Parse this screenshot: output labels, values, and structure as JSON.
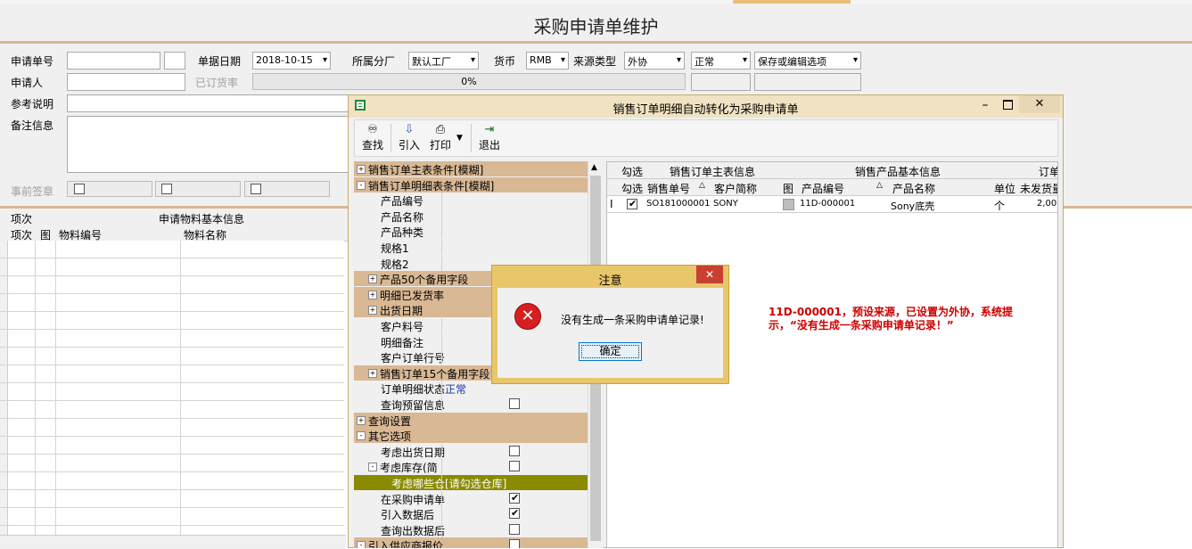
{
  "page_title": "采购申请单维护",
  "form": {
    "request_no_label": "申请单号",
    "date_label": "单据日期",
    "date_value": "2018-10-15",
    "branch_label": "所属分厂",
    "branch_value": "默认工厂",
    "currency_label": "货币",
    "currency_value": "RMB",
    "source_type_label": "来源类型",
    "source_type_value": "外协",
    "status_value": "正常",
    "save_option_value": "保存或编辑选项",
    "applicant_label": "申请人",
    "ordered_rate_label": "已订货率",
    "progress_text": "0%",
    "progress_value": 0,
    "ref_desc_label": "参考说明",
    "remark_label": "备注信息",
    "presign_label": "事前签章"
  },
  "material_grid": {
    "col_index": "项次",
    "group_header": "申请物料基本信息",
    "col_pic": "图",
    "col_code": "物料编号",
    "col_name": "物料名称"
  },
  "dialog": {
    "title": "销售订单明细自动转化为采购申请单",
    "toolbar": {
      "find": "查找",
      "import": "引入",
      "print": "打印",
      "exit": "退出"
    },
    "tree": [
      {
        "label": "销售订单主表条件[模糊]",
        "type": "hdr",
        "expander": "+"
      },
      {
        "label": "销售订单明细表条件[模糊]",
        "type": "hdr",
        "expander": "-"
      },
      {
        "label": "产品编号",
        "type": "item"
      },
      {
        "label": "产品名称",
        "type": "item"
      },
      {
        "label": "产品种类",
        "type": "item"
      },
      {
        "label": "规格1",
        "type": "item"
      },
      {
        "label": "规格2",
        "type": "item"
      },
      {
        "label": "产品50个备用字段",
        "type": "sub",
        "expander": "+"
      },
      {
        "label": "明细已发货率",
        "type": "sub",
        "expander": "+"
      },
      {
        "label": "出货日期",
        "type": "sub",
        "expander": "+"
      },
      {
        "label": "客户料号",
        "type": "item"
      },
      {
        "label": "明细备注",
        "type": "item"
      },
      {
        "label": "客户订单行号",
        "type": "item"
      },
      {
        "label": "销售订单15个备用字段",
        "type": "sub",
        "expander": "+"
      },
      {
        "label": "订单明细状态",
        "type": "item",
        "value": "正常"
      },
      {
        "label": "查询预留信息",
        "type": "item",
        "check": false
      },
      {
        "label": "查询设置",
        "type": "hdr",
        "expander": "+"
      },
      {
        "label": "其它选项",
        "type": "hdr",
        "expander": "-"
      },
      {
        "label": "考虑出货日期",
        "type": "item",
        "check": false
      },
      {
        "label": "考虑库存(简",
        "type": "sub2",
        "expander": "-",
        "check": false
      },
      {
        "label": "考虑哪些仓",
        "type": "sel",
        "value": "[请勾选仓库]"
      },
      {
        "label": "在采购申请单",
        "type": "item",
        "check": true
      },
      {
        "label": "引入数据后",
        "type": "item",
        "check": true
      },
      {
        "label": "查询出数据后",
        "type": "item",
        "check": false
      },
      {
        "label": "引入供应商报价",
        "type": "hdr2",
        "expander": "-",
        "check": false
      }
    ],
    "result_grid": {
      "group_check": "勾选",
      "group_main": "销售订单主表信息",
      "group_product": "销售产品基本信息",
      "group_order": "订单",
      "cols": [
        "勾选",
        "销售单号",
        "客户简称",
        "图",
        "产品编号",
        "产品名称",
        "单位",
        "未发货量"
      ],
      "rows": [
        {
          "indicator": "I",
          "checked": true,
          "order_no": "SO181000001",
          "customer": "SONY",
          "product_code": "11D-000001",
          "product_name": "Sony底壳",
          "unit": "个",
          "qty": "2,00"
        }
      ]
    }
  },
  "alert": {
    "title": "注意",
    "message": "没有生成一条采购申请单记录!",
    "ok_label": "确定"
  },
  "annotation": {
    "line1": "11D-000001，预设来源，已设置为外协，系统提",
    "line2": "示，“没有生成一条采购申请单记录！”"
  },
  "colors": {
    "accent_bar": "#e8c07a",
    "tree_header": "#d9b894",
    "selected_row": "#8a8a00",
    "dialog_title_bg": "#f0e2c2",
    "alert_border": "#e8c66a",
    "close_red": "#c84031",
    "annotation_red": "#cc0000"
  }
}
